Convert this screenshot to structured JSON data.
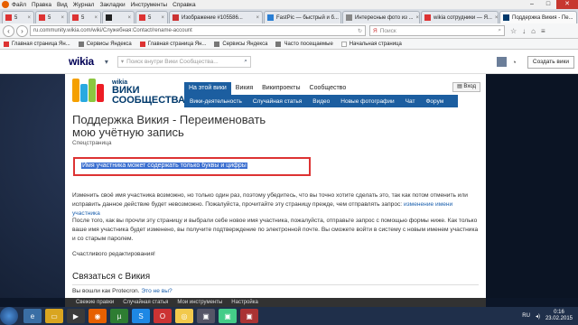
{
  "menu": {
    "items": [
      "Файл",
      "Правка",
      "Вид",
      "Журнал",
      "Закладки",
      "Инструменты",
      "Справка"
    ]
  },
  "tabs": [
    {
      "label": "5"
    },
    {
      "label": "5"
    },
    {
      "label": "5"
    },
    {
      "label": ""
    },
    {
      "label": "5"
    },
    {
      "label": "Изображение #105586..."
    },
    {
      "label": "FastPic — быстрый и б..."
    },
    {
      "label": "Интересные фото из ..."
    },
    {
      "label": "wikia сотрудники — Я..."
    },
    {
      "label": "Поддержка Викия - Пе..."
    }
  ],
  "urlbar": {
    "url": "ru.community.wikia.com/wiki/Служебная:Contact/rename-account",
    "search_placeholder": "Поиск"
  },
  "bookmarks": [
    "Главная страница Ян...",
    "Сервисы Яндекса",
    "Главная страница Ян...",
    "Сервисы Яндекса",
    "Часто посещаемые",
    "Начальная страница"
  ],
  "wikia_bar": {
    "logo": "wikia",
    "search_placeholder": "Поиск внутри Вики Сообщества...",
    "create_label": "Создать вики"
  },
  "site": {
    "logo_small": "wikia",
    "logo_big": "ВИКИ",
    "logo_big2": "СООБЩЕСТВА",
    "tabs": [
      "На этой вики",
      "Викия",
      "Википроекты",
      "Сообщество"
    ],
    "subnav": [
      "Вики-деятельность",
      "Случайная статья",
      "Видео",
      "Новые фотографии",
      "Чат",
      "Форум"
    ],
    "follow_label": "Вход"
  },
  "content": {
    "title_line1": "Поддержка Викия - Переименовать",
    "title_line2": "мою учётную запись",
    "subtitle": "Спецстраница",
    "highlight": "Имя участника может содержать только буквы и цифры",
    "p1": "Изменить своё имя участника возможно, но только один раз, поэтому убедитесь, что вы точно хотите сделать это, так как потом отменить или исправить данное действие будет невозможно. Пожалуйста, прочитайте эту страницу прежде, чем отправлять запрос:",
    "p1_link": "изменение имени участника",
    "p2": "После того, как вы прочли эту страницу и выбрали себе новое имя участника, пожалуйста, отправьте запрос с помощью формы ниже. Как только ваше имя участника будет изменено, вы получите подтверждение по электронной почте. Вы сможете войти в систему с новым именем участника и со старым паролем.",
    "p3": "Счастливого редактирования!",
    "h2": "Связаться с Викия",
    "p4": "Вы вошли как Protecron.",
    "p4_link": "Это не вы?"
  },
  "wikia_toolbar": [
    "Свежие правки",
    "Случайная статья",
    "Мои инструменты",
    "Настройка"
  ],
  "taskbar": {
    "lang": "RU",
    "time": "0:16",
    "date": "23.02.2015"
  }
}
